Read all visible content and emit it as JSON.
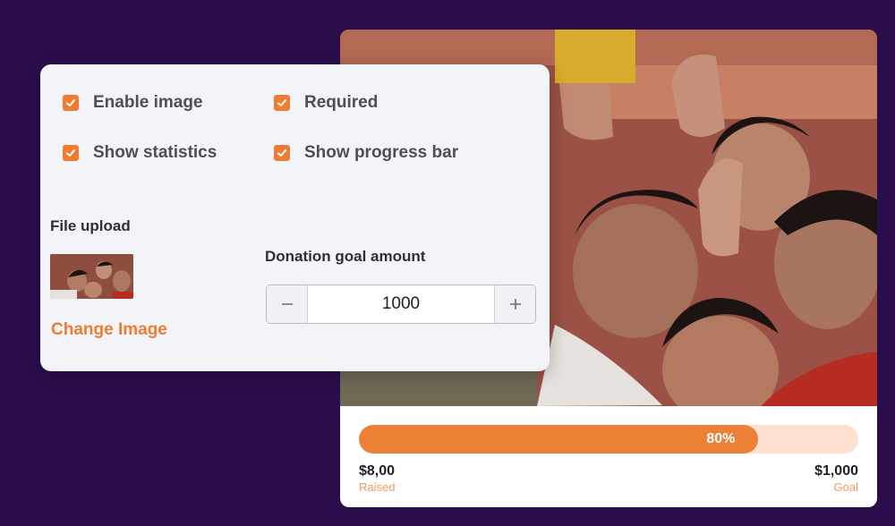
{
  "settings": {
    "checkboxes": [
      {
        "label": "Enable image",
        "checked": true
      },
      {
        "label": "Required",
        "checked": true
      },
      {
        "label": "Show statistics",
        "checked": true
      },
      {
        "label": "Show progress bar",
        "checked": true
      }
    ],
    "file_upload_label": "File upload",
    "change_image_label": "Change Image",
    "goal_label": "Donation goal amount",
    "goal_value": "1000"
  },
  "campaign": {
    "progress_percent": 80,
    "progress_text": "80%",
    "raised_amount": "$8,00",
    "raised_caption": "Raised",
    "goal_amount": "$1,000",
    "goal_caption": "Goal"
  },
  "colors": {
    "background": "#2a0e4c",
    "accent": "#ee7c32",
    "progress_track": "#fde0d0",
    "card": "#f3f4f7"
  },
  "icons": {
    "checkbox": "checkmark-icon",
    "decrement": "minus-icon",
    "increment": "plus-icon"
  }
}
